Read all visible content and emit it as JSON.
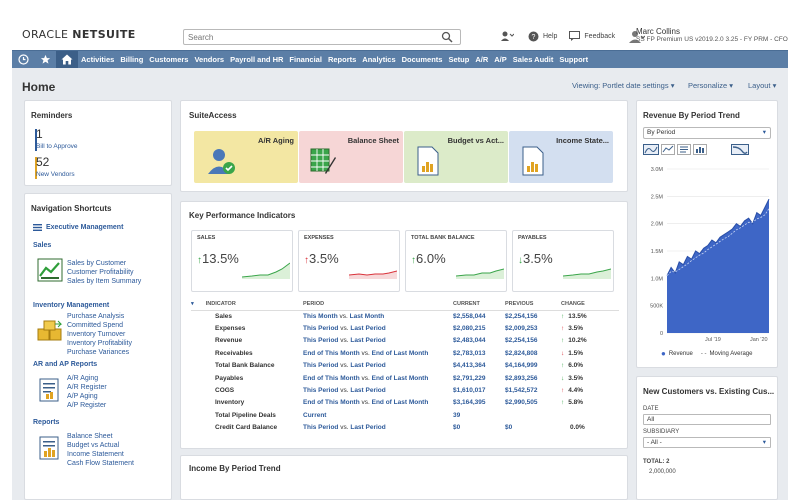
{
  "header": {
    "logo_left": "ORACLE",
    "logo_right": "NETSUITE",
    "search_placeholder": "Search",
    "help": "Help",
    "feedback": "Feedback",
    "user_name": "Marc Collins",
    "user_detail_1": "SS FP Premium US v2019.2.0 3.25 - FY PRM - CFO"
  },
  "nav": {
    "items": [
      "Activities",
      "Billing",
      "Customers",
      "Vendors",
      "Payroll and HR",
      "Financial",
      "Reports",
      "Analytics",
      "Documents",
      "Setup",
      "A/R",
      "A/P",
      "Sales Audit",
      "Support"
    ]
  },
  "page": {
    "title": "Home",
    "viewing": "Viewing: Portlet date settings",
    "personalize": "Personalize",
    "layout": "Layout"
  },
  "reminders": {
    "title": "Reminders",
    "items": [
      {
        "count": "1",
        "label": "Bill to Approve"
      },
      {
        "count": "52",
        "label": "New Vendors"
      }
    ]
  },
  "shortcuts": {
    "title": "Navigation Shortcuts",
    "exec": "Executive Management",
    "groups": [
      {
        "name": "Sales",
        "links": [
          "Sales by Customer",
          "Customer Profitability",
          "Sales by Item Summary"
        ]
      },
      {
        "name": "Inventory Management",
        "links": [
          "Purchase Analysis",
          "Committed Spend",
          "Inventory Turnover",
          "Inventory Profitability",
          "Purchase Variances"
        ]
      },
      {
        "name": "AR and AP Reports",
        "links": [
          "A/R Aging",
          "A/R Register",
          "A/P Aging",
          "A/P Register"
        ]
      },
      {
        "name": "Reports",
        "links": [
          "Balance Sheet",
          "Budget vs Actual",
          "Income Statement",
          "Cash Flow Statement"
        ]
      }
    ]
  },
  "suiteaccess": {
    "title": "SuiteAccess",
    "tiles": [
      {
        "label": "A/R Aging",
        "color": "#f3e7a3"
      },
      {
        "label": "Balance Sheet",
        "color": "#f6d6d6"
      },
      {
        "label": "Budget vs Act...",
        "color": "#dcebc9"
      },
      {
        "label": "Income State...",
        "color": "#d3dff0"
      }
    ]
  },
  "kpi": {
    "title": "Key Performance Indicators",
    "cards": [
      {
        "name": "SALES",
        "value": "13.5%",
        "dir": "up"
      },
      {
        "name": "EXPENSES",
        "value": "3.5%",
        "dir": "up"
      },
      {
        "name": "TOTAL BANK BALANCE",
        "value": "6.0%",
        "dir": "up"
      },
      {
        "name": "PAYABLES",
        "value": "3.5%",
        "dir": "down"
      }
    ],
    "headers": [
      "INDICATOR",
      "PERIOD",
      "CURRENT",
      "PREVIOUS",
      "CHANGE"
    ],
    "rows": [
      {
        "ind": "Sales",
        "p1": "This Month",
        "vs": "vs.",
        "p2": "Last Month",
        "cur": "$2,558,044",
        "prev": "$2,254,156",
        "chg": "13.5%",
        "dir": "up"
      },
      {
        "ind": "Expenses",
        "p1": "This Period",
        "vs": "vs.",
        "p2": "Last Period",
        "cur": "$2,080,215",
        "prev": "$2,009,253",
        "chg": "3.5%",
        "dir": "up-red"
      },
      {
        "ind": "Revenue",
        "p1": "This Period",
        "vs": "vs.",
        "p2": "Last Period",
        "cur": "$2,483,044",
        "prev": "$2,254,156",
        "chg": "10.2%",
        "dir": "up"
      },
      {
        "ind": "Receivables",
        "p1": "End of This Month",
        "vs": "vs.",
        "p2": "End of Last Month",
        "cur": "$2,783,013",
        "prev": "$2,824,808",
        "chg": "1.5%",
        "dir": "down-red"
      },
      {
        "ind": "Total Bank Balance",
        "p1": "This Period",
        "vs": "vs.",
        "p2": "Last Period",
        "cur": "$4,413,364",
        "prev": "$4,164,999",
        "chg": "6.0%",
        "dir": "up"
      },
      {
        "ind": "Payables",
        "p1": "End of This Month",
        "vs": "vs.",
        "p2": "End of Last Month",
        "cur": "$2,791,229",
        "prev": "$2,893,256",
        "chg": "3.5%",
        "dir": "down"
      },
      {
        "ind": "COGS",
        "p1": "This Period",
        "vs": "vs.",
        "p2": "Last Period",
        "cur": "$1,610,017",
        "prev": "$1,542,572",
        "chg": "4.4%",
        "dir": "up-red"
      },
      {
        "ind": "Inventory",
        "p1": "End of This Month",
        "vs": "vs.",
        "p2": "End of Last Month",
        "cur": "$3,164,395",
        "prev": "$2,990,505",
        "chg": "5.8%",
        "dir": "up"
      },
      {
        "ind": "Total Pipeline Deals",
        "p1": "Current",
        "vs": "",
        "p2": "",
        "cur": "39",
        "prev": "",
        "chg": "",
        "dir": ""
      },
      {
        "ind": "Credit Card Balance",
        "p1": "This Period",
        "vs": "vs.",
        "p2": "Last Period",
        "cur": "$0",
        "prev": "$0",
        "chg": "0.0%",
        "dir": ""
      }
    ]
  },
  "income": {
    "title": "Income By Period Trend"
  },
  "revenue": {
    "title": "Revenue By Period Trend",
    "select": "By Period",
    "legend_revenue": "Revenue",
    "legend_ma": "Moving Average"
  },
  "chart_data": {
    "type": "area",
    "title": "Revenue By Period Trend",
    "ylim": [
      0,
      3000000
    ],
    "yticks": [
      "0",
      "500K",
      "1.0M",
      "1.5M",
      "2.0M",
      "2.5M",
      "3.0M"
    ],
    "xticks": [
      "Jul '19",
      "Jan '20"
    ],
    "series": [
      {
        "name": "Revenue",
        "values": [
          1.05,
          1.2,
          1.1,
          1.3,
          1.25,
          1.4,
          1.35,
          1.5,
          1.45,
          1.55,
          1.6,
          1.7,
          1.65,
          1.75,
          1.8,
          1.85,
          1.9,
          2.0,
          1.95,
          2.05,
          2.1,
          2.0,
          2.2,
          2.15,
          2.3,
          2.45
        ]
      }
    ],
    "grid": true,
    "legend": "bottom"
  },
  "newcust": {
    "title": "New Customers vs. Existing Cus...",
    "date_label": "DATE",
    "date_value": "All",
    "sub_label": "SUBSIDIARY",
    "sub_value": "- All -",
    "total_label": "TOTAL: 2",
    "first_tick": "2,000,000"
  },
  "colors": {
    "nav": "#5b7ea6",
    "link": "#2d5a9a",
    "up": "#3aa54a",
    "down": "#d9323a"
  }
}
